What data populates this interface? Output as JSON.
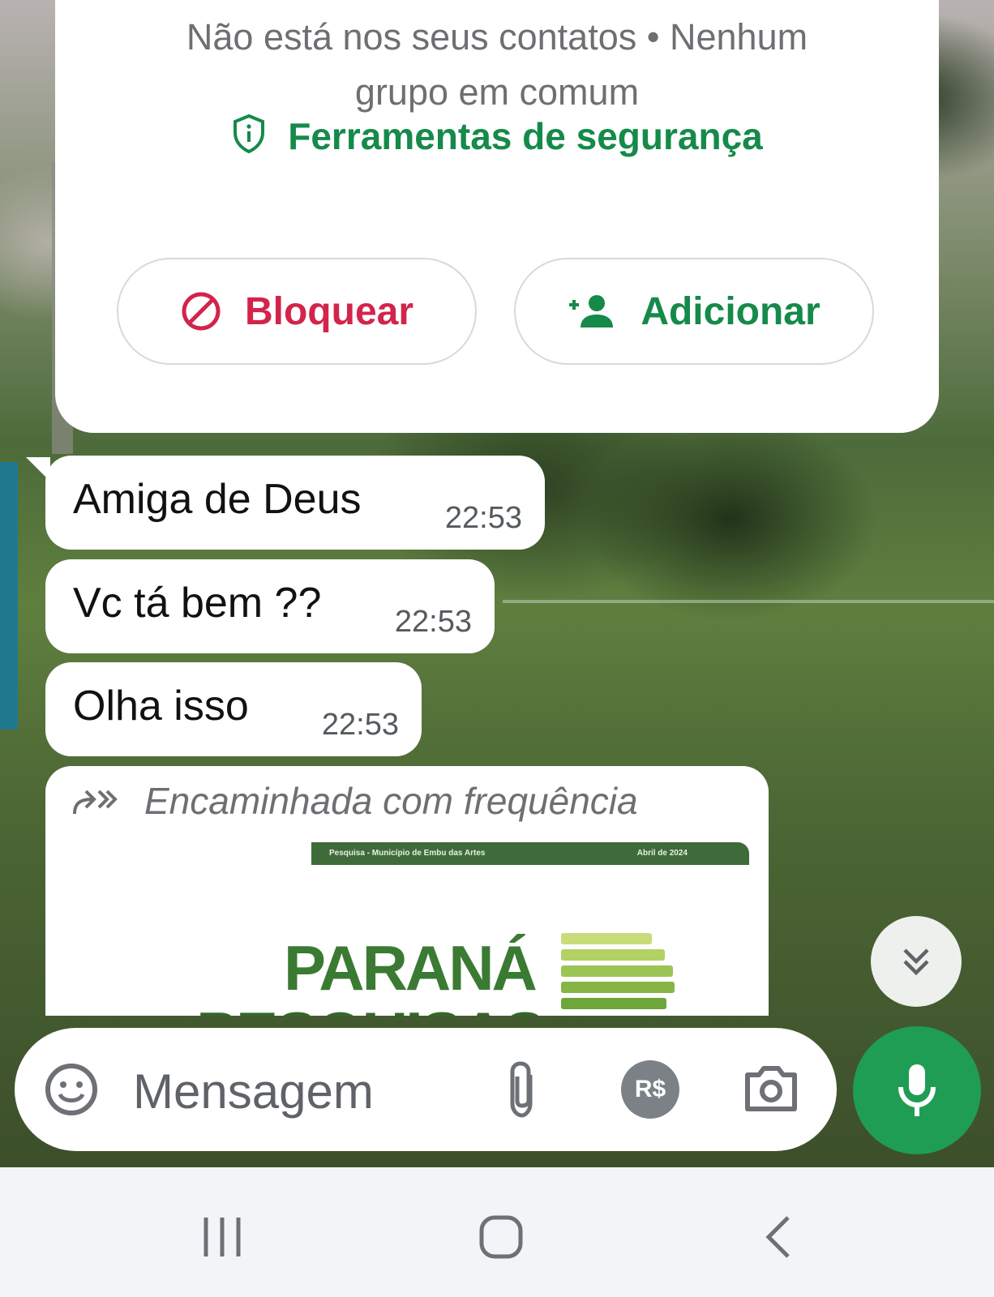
{
  "chat_header": {
    "contact_info": "Não está nos seus contatos • Nenhum grupo em comum",
    "safety_tools": "Ferramentas de segurança",
    "block_label": "Bloquear",
    "add_label": "Adicionar"
  },
  "messages": [
    {
      "text": "Amiga de Deus",
      "time": "22:53"
    },
    {
      "text": "Vc tá bem ??",
      "time": "22:53"
    },
    {
      "text": "Olha isso",
      "time": "22:53"
    }
  ],
  "forwarded": {
    "label": "Encaminhada com frequência",
    "doc_header_left": "Pesquisa - Município de Embu das Artes",
    "doc_header_right": "Abril de 2024",
    "brand_line1": "PARANÁ",
    "brand_line2": "PESQUISAS"
  },
  "composer": {
    "placeholder": "Mensagem",
    "payment_label": "R$"
  },
  "colors": {
    "accent_green": "#158a4a",
    "block_red": "#d3244b",
    "mic_green": "#1f9d55"
  },
  "icons": [
    "shield-icon",
    "block-icon",
    "add-contact-icon",
    "forward-icon",
    "scroll-down-icon",
    "emoji-icon",
    "attach-icon",
    "payment-icon",
    "camera-icon",
    "mic-icon",
    "recents-icon",
    "home-icon",
    "back-icon"
  ]
}
